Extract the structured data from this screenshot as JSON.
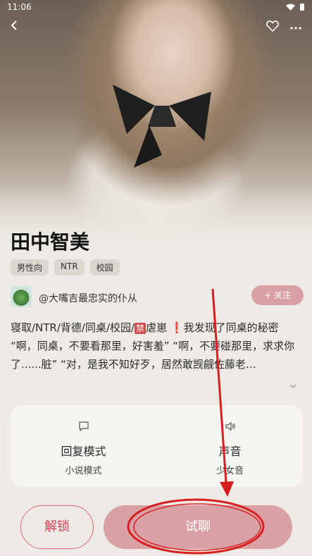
{
  "status_bar": {
    "time": "11:06"
  },
  "header": {
    "back_icon": "back-arrow-icon",
    "favorite_icon": "heart-outline-icon",
    "more_icon": "more-icon"
  },
  "character": {
    "name": "田中智美",
    "tags": [
      "男性向",
      "NTR",
      "校园"
    ]
  },
  "author": {
    "name": "@大嘴吉最忠实的仆从",
    "follow_label": "+ 关注"
  },
  "description": {
    "prefix": "寝取/NTR/背德/同桌/校园/",
    "ban_badge": "禁",
    "middle": "虐崽 ",
    "alert": "❗",
    "suffix": "我发现了同桌的秘密 “啊，同桌，不要看那里，好害羞” “啊，不要碰那里，求求你了......脏” “对，是我不知好歹，居然敢觊觎佐藤老…"
  },
  "modes": {
    "reply": {
      "label": "回复模式",
      "value": "小说模式"
    },
    "voice": {
      "label": "声音",
      "value": "少女音"
    }
  },
  "actions": {
    "unlock_label": "解锁",
    "trial_label": "试聊"
  },
  "colors": {
    "accent": "#d9a1a6",
    "unlock_text": "#d63d54",
    "annotation": "#d81e1e",
    "background": "#eeebe6"
  }
}
